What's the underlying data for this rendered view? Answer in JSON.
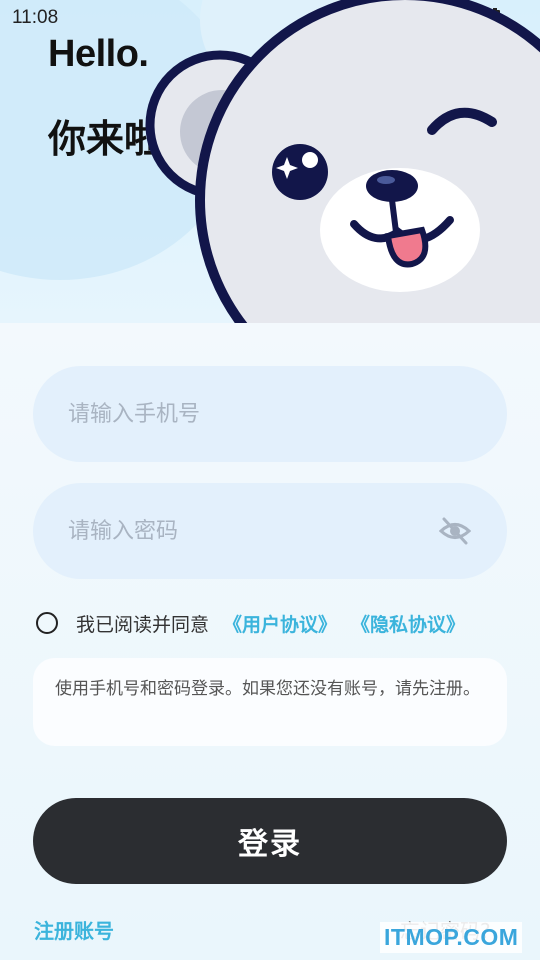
{
  "status_bar": {
    "time": "11:08"
  },
  "header": {
    "greeting": "Hello.",
    "welcome": "你来啦"
  },
  "form": {
    "phone_placeholder": "请输入手机号",
    "password_placeholder": "请输入密码"
  },
  "agreement": {
    "text": "我已阅读并同意",
    "user_agreement": "《用户协议》",
    "privacy_policy": "《隐私协议》"
  },
  "hint": "使用手机号和密码登录。如果您还没有账号，请先注册。",
  "login_button": "登录",
  "register_link": "注册账号",
  "forgot_link": "忘记密码?",
  "watermark": "ITMOP.COM",
  "colors": {
    "accent": "#3bb4dc",
    "button": "#2b2d31",
    "field": "#e3f0fc"
  }
}
